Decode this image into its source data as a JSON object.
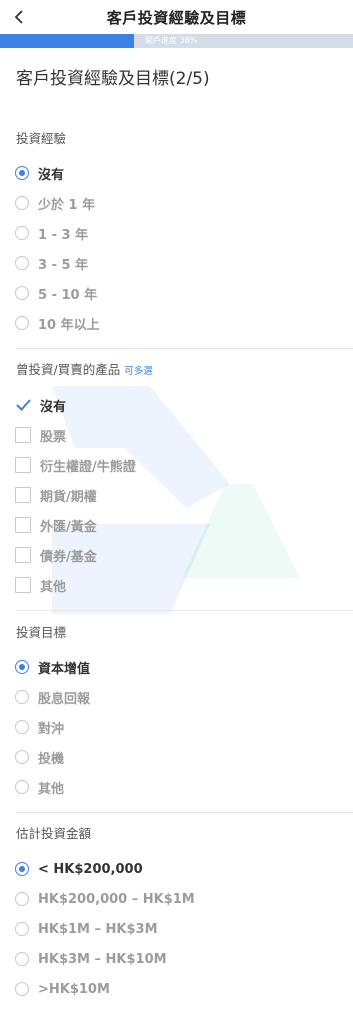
{
  "header": {
    "title": "客戶投資經驗及目標",
    "back_icon": "chevron-left-icon"
  },
  "progress": {
    "label": "開戶進度 38%",
    "percent": 38,
    "fill_color": "#3c82e6",
    "track_color": "#d5dbe7"
  },
  "page_title": "客戶投資經驗及目標(2/5)",
  "sections": [
    {
      "label": "投資經驗",
      "type": "radio",
      "options": [
        {
          "label": "沒有",
          "selected": true
        },
        {
          "label": "少於 1 年",
          "selected": false
        },
        {
          "label": "1 - 3 年",
          "selected": false
        },
        {
          "label": "3 - 5 年",
          "selected": false
        },
        {
          "label": "5 - 10 年",
          "selected": false
        },
        {
          "label": "10 年以上",
          "selected": false
        }
      ]
    },
    {
      "label": "曾投資/買賣的產品",
      "hint": "可多選",
      "type": "checkbox",
      "options": [
        {
          "label": "沒有",
          "selected": true
        },
        {
          "label": "股票",
          "selected": false
        },
        {
          "label": "衍生權證/牛熊證",
          "selected": false
        },
        {
          "label": "期貨/期權",
          "selected": false
        },
        {
          "label": "外匯/黃金",
          "selected": false
        },
        {
          "label": "債券/基金",
          "selected": false
        },
        {
          "label": "其他",
          "selected": false
        }
      ]
    },
    {
      "label": "投資目標",
      "type": "radio",
      "options": [
        {
          "label": "資本增值",
          "selected": true
        },
        {
          "label": "股息回報",
          "selected": false
        },
        {
          "label": "對沖",
          "selected": false
        },
        {
          "label": "投機",
          "selected": false
        },
        {
          "label": "其他",
          "selected": false
        }
      ]
    },
    {
      "label": "估計投資金額",
      "type": "radio",
      "options": [
        {
          "label": "< HK$200,000",
          "selected": true
        },
        {
          "label": "HK$200,000 – HK$1M",
          "selected": false
        },
        {
          "label": "HK$1M – HK$3M",
          "selected": false
        },
        {
          "label": "HK$3M – HK$10M",
          "selected": false
        },
        {
          "label": ">HK$10M",
          "selected": false
        }
      ]
    }
  ],
  "colors": {
    "accent": "#3c82e6",
    "unselected_text": "#9c9c9c",
    "selected_text": "#333333"
  }
}
